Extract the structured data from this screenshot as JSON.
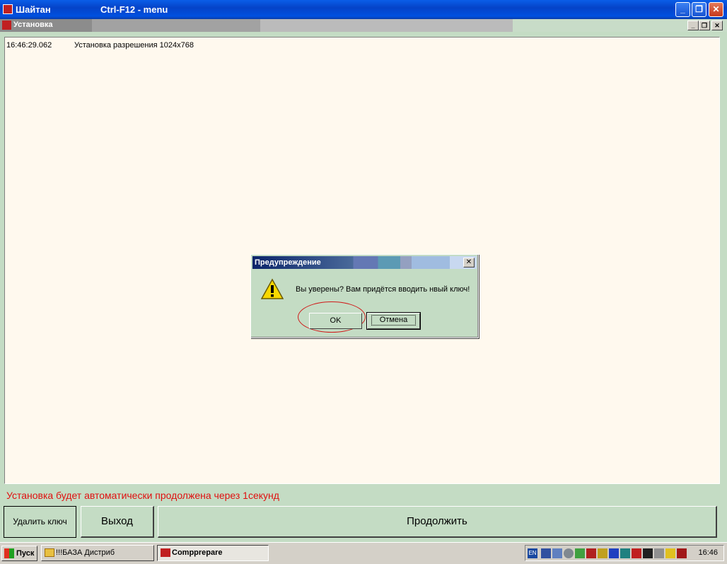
{
  "window": {
    "title": "Шайтан",
    "hint": "Ctrl-F12 - menu",
    "minimize": "_",
    "maximize": "❐",
    "close": "✕"
  },
  "mdi": {
    "title": "Установка",
    "min": "_",
    "restore": "❐",
    "close": "✕"
  },
  "log": [
    {
      "time": "16:46:29.062",
      "message": "Установка разрешения 1024x768"
    }
  ],
  "dialog": {
    "title": "Предупреждение",
    "close": "✕",
    "icon": "warning-icon",
    "message": "Вы уверены? Вам придётся вводить нвый ключ!",
    "ok": "OK",
    "cancel": "Отмена"
  },
  "notice": "Установка будет автоматически продолжена через 1секунд",
  "buttons": {
    "delete_key": "Удалить ключ",
    "exit": "Выход",
    "continue": "Продолжить"
  },
  "taskbar": {
    "start": "Пуск",
    "tasks": [
      "!!!БАЗА Дистриб",
      "Compprepare"
    ],
    "lang": "EN",
    "clock": "16:46"
  },
  "colors": {
    "notice": "#e01010",
    "annotation": "#d01818",
    "log_bg": "#fff9ee",
    "app_bg": "#c4dcc4"
  }
}
